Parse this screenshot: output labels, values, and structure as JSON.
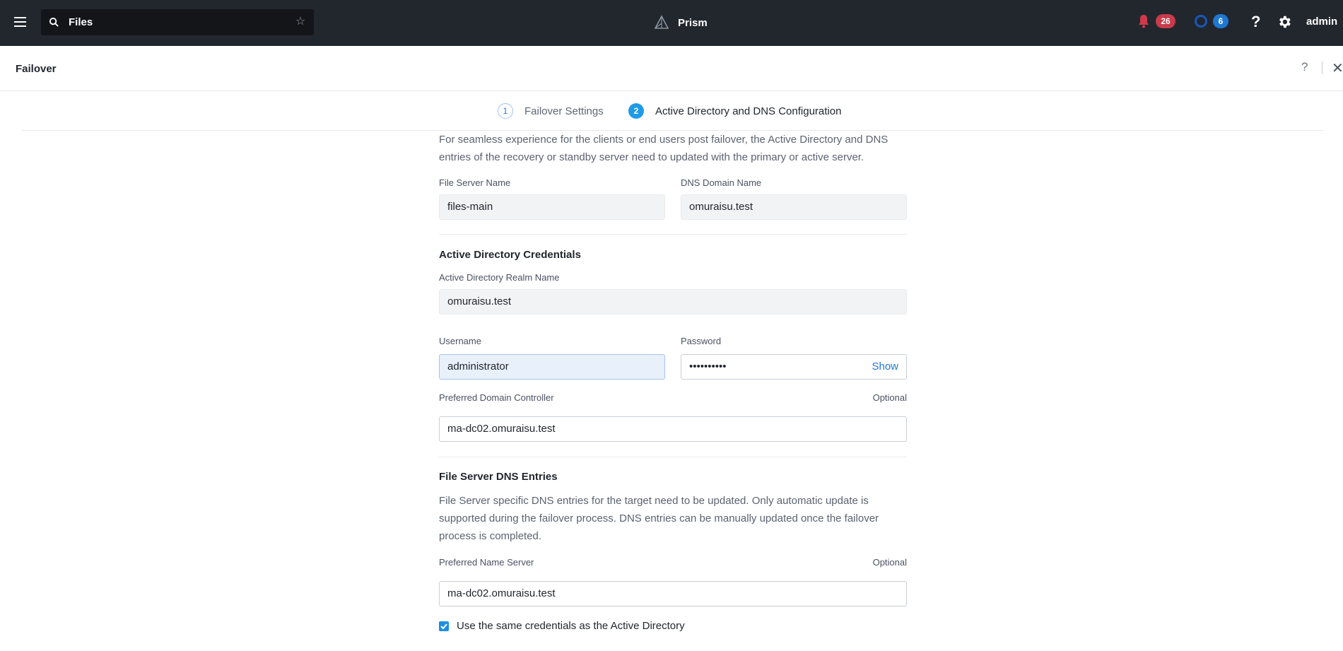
{
  "topbar": {
    "search_value": "Files",
    "app_name": "Prism",
    "alerts_count": "26",
    "tasks_count": "6",
    "help_label": "?",
    "user_label": "admin"
  },
  "modal": {
    "title": "Failover",
    "help_label": "?",
    "close_label": "✕"
  },
  "steps": [
    {
      "number": "1",
      "label": "Failover Settings"
    },
    {
      "number": "2",
      "label": "Active Directory and DNS Configuration"
    }
  ],
  "form": {
    "intro": "For seamless experience for the clients or end users post failover, the Active Directory and DNS entries of the recovery or standby server need to updated with the primary or active server.",
    "file_server_name": {
      "label": "File Server Name",
      "value": "files-main"
    },
    "dns_domain_name": {
      "label": "DNS Domain Name",
      "value": "omuraisu.test"
    },
    "ad_section_title": "Active Directory Credentials",
    "ad_realm": {
      "label": "Active Directory Realm Name",
      "value": "omuraisu.test"
    },
    "username": {
      "label": "Username",
      "value": "administrator"
    },
    "password": {
      "label": "Password",
      "value": "••••••••••",
      "show_label": "Show"
    },
    "preferred_dc": {
      "label": "Preferred Domain Controller",
      "optional": "Optional",
      "value": "ma-dc02.omuraisu.test"
    },
    "dns_section_title": "File Server DNS Entries",
    "dns_desc": "File Server specific DNS entries for the target need to be updated. Only automatic update is supported during the failover process. DNS entries can be manually updated once the failover process is completed.",
    "preferred_ns": {
      "label": "Preferred Name Server",
      "optional": "Optional",
      "value": "ma-dc02.omuraisu.test"
    },
    "same_creds": {
      "label": "Use the same credentials as the Active Directory",
      "checked": true
    }
  },
  "colors": {
    "topbar_bg": "#22272e",
    "accent": "#1f78d1",
    "alert_badge": "#c93b4a",
    "task_badge": "#1f78d1"
  },
  "icons": [
    "menu-icon",
    "search-icon",
    "star-icon",
    "prism-logo-icon",
    "bell-icon",
    "tasks-ring-icon",
    "help-icon",
    "gear-icon",
    "close-icon",
    "checkbox-checked-icon"
  ]
}
